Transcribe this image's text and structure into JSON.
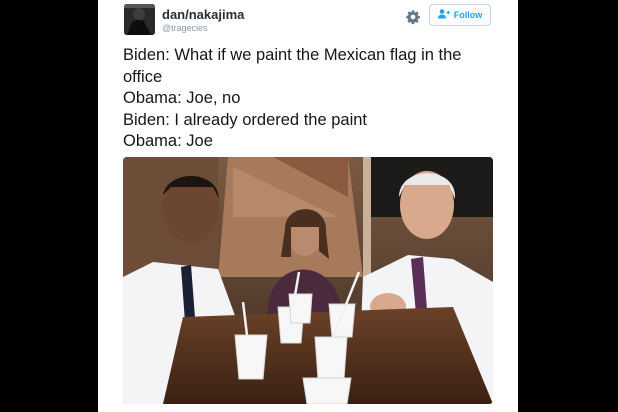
{
  "tweet": {
    "user": {
      "name": "dan/nakajima",
      "handle": "@tragecies"
    },
    "follow_label": "Follow",
    "lines": [
      "Biden: What if we paint the Mexican flag in the office",
      "Obama: Joe, no",
      "Biden: I already ordered the paint",
      "Obama: Joe"
    ]
  },
  "icons": {
    "settings": "gear-icon",
    "follow": "add-user-icon"
  },
  "colors": {
    "accent": "#1da1f2",
    "name": "#292f33",
    "handle": "#8899a6",
    "text": "#14171a",
    "background": "#000000"
  }
}
